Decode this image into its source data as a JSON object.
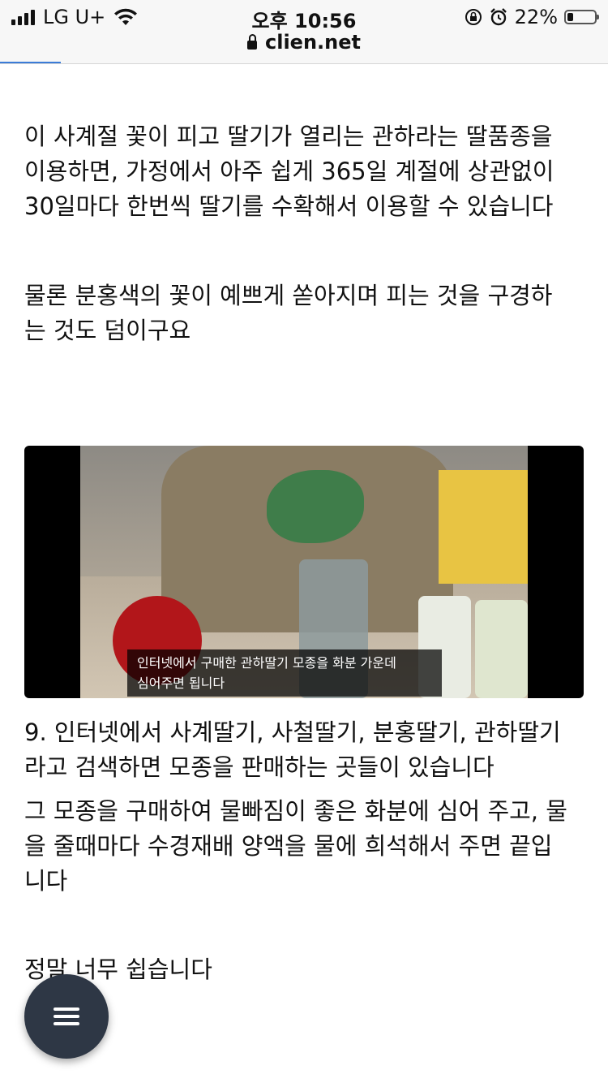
{
  "status_bar": {
    "carrier": "LG U+",
    "time": "오후 10:56",
    "battery_percent": "22%",
    "battery_level": 0.22,
    "icons": [
      "signal-icon",
      "wifi-icon",
      "orientation-lock-icon",
      "alarm-icon",
      "battery-icon"
    ]
  },
  "address_bar": {
    "domain": "clien.net",
    "icon": "lock-icon"
  },
  "page_load_progress": 0.1,
  "article": {
    "paragraph_1": "이 사계절 꽃이 피고 딸기가 열리는 관하라는 딸품종을\n이용하면, 가정에서 아주 쉽게 365일 계절에 상관없이\n30일마다 한번씩 딸기를 수확해서 이용할 수 있습니다",
    "paragraph_2": "물론 분홍색의 꽃이 예쁘게 쏟아지며 피는 것을 구경하\n는 것도 덤이구요",
    "video_caption": "인터넷에서 구매한 관하딸기 모종을 화분 가운데\n심어주면 됩니다",
    "paragraph_3": "9. 인터넷에서 사계딸기, 사철딸기, 분홍딸기, 관하딸기\n라고 검색하면 모종을 판매하는 곳들이 있습니다",
    "paragraph_4": "그 모종을 구매하여 물빠짐이 좋은 화분에 심어 주고, 물\n을 줄때마다 수경재배 양액을 물에 희석해서 주면 끝입\n니다",
    "paragraph_5": "정말 너무 쉽습니다"
  },
  "menu_button": {
    "icon": "hamburger-menu-icon"
  }
}
